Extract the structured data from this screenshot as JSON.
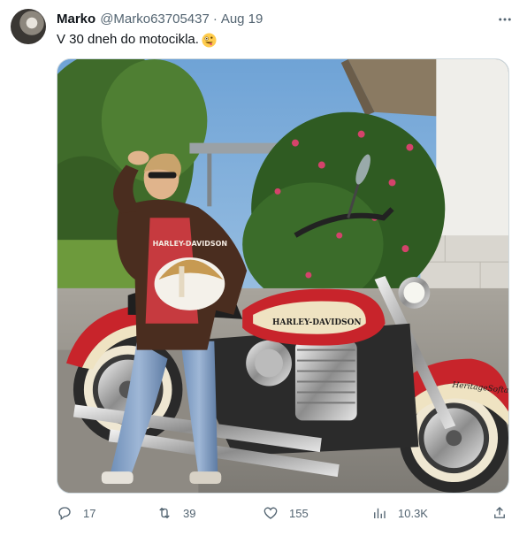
{
  "author": {
    "display_name": "Marko",
    "handle": "@Marko63705437",
    "separator": "·",
    "date": "Aug 19"
  },
  "tweet": {
    "text": "V 30 dneh do motocikla.",
    "emoji": "zany-face-emoji"
  },
  "media": {
    "tank_brand": "HARLEY-DAVIDSON",
    "fender_script": "HeritageSoftail",
    "shirt_text": "HARLEY-DAVIDSON"
  },
  "actions": {
    "replies": "17",
    "retweets": "39",
    "likes": "155",
    "views": "10.3K"
  },
  "colors": {
    "text_primary": "#0f1419",
    "text_secondary": "#536471",
    "border": "#cfd9de",
    "bike_red": "#c8242b",
    "bike_cream": "#efe3c2"
  },
  "icons": [
    "more-icon",
    "reply-icon",
    "retweet-icon",
    "like-icon",
    "views-icon",
    "share-icon"
  ]
}
